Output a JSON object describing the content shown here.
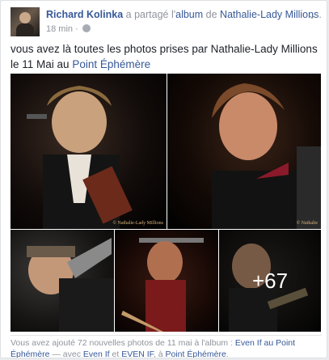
{
  "post": {
    "author": "Richard Kolinka",
    "shared_text": "a partagé l'",
    "album_word": "album",
    "of_text": "de",
    "album_owner": "Nathalie-Lady Millions",
    "time": "18 min",
    "separator": "·",
    "more_icon": "chevron-down-icon",
    "privacy_icon": "globe-icon",
    "text_main": "vous avez là toutes les photos prises par Nathalie-Lady Millions le 11 Mai au",
    "text_link": "Point Éphémère"
  },
  "photos": {
    "watermark": "© Nathalie-Lady Millions",
    "watermark_short": "© Nathalie",
    "more_count": "+67"
  },
  "caption": {
    "part1": "Vous avez ajouté 72 nouvelles photos de 11 mai à l'album :",
    "album": "Even If au Point Éphémère",
    "part2": "— avec",
    "tag1": "Even If",
    "and": "et",
    "tag2": "EVEN IF",
    "at": ", à",
    "place": "Point Éphémère",
    "end": "."
  }
}
